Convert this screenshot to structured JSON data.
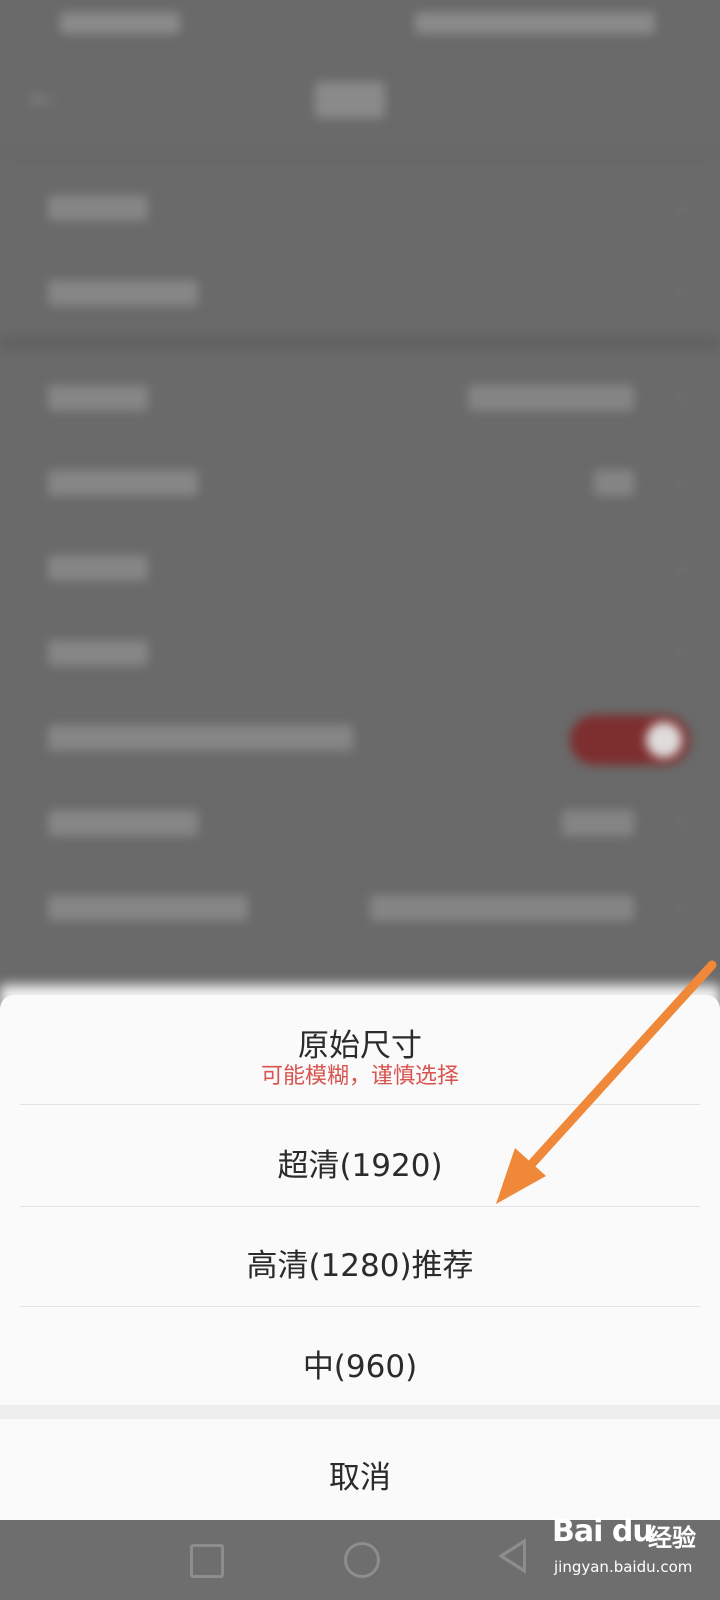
{
  "dialog": {
    "options": [
      {
        "label": "原始尺寸",
        "hint": "可能模糊，谨慎选择"
      },
      {
        "label": "超清(1920)"
      },
      {
        "label": "高清(1280)推荐"
      },
      {
        "label": "中(960)"
      }
    ],
    "cancel_label": "取消"
  },
  "background": {
    "toggle_color": "#7d2e2e"
  },
  "annotation": {
    "arrow_color": "#f0883a"
  },
  "watermark": {
    "logo": "Bai du",
    "cn": "经验",
    "url": "jingyan.baidu.com"
  },
  "icons": {
    "back": "back-arrow-icon",
    "chevron": "chevron-right-icon",
    "nav_recent": "square-icon",
    "nav_home": "circle-icon",
    "nav_back": "triangle-back-icon"
  }
}
